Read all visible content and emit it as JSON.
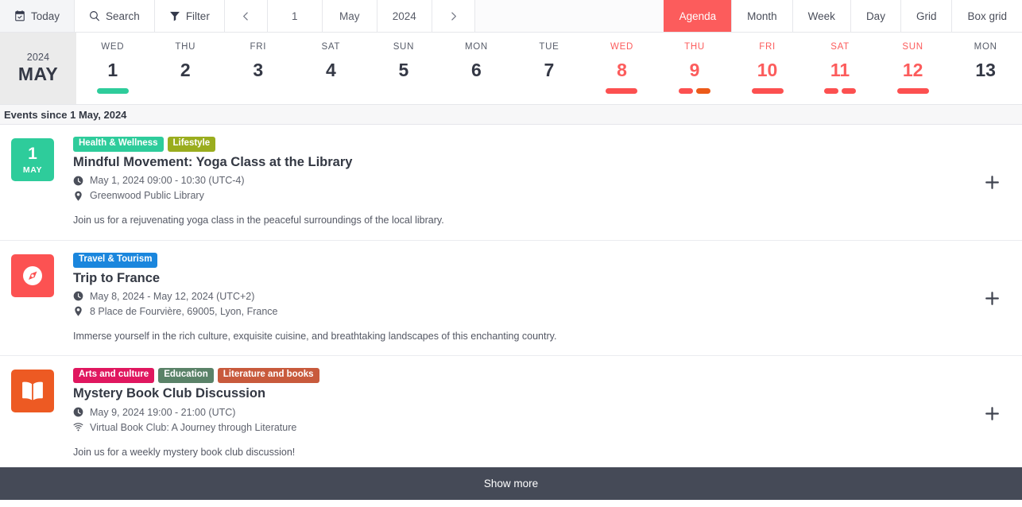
{
  "toolbar": {
    "today_label": "Today",
    "search_label": "Search",
    "filter_label": "Filter",
    "prev_label": "‹",
    "next_label": "›",
    "nav_day": "1",
    "nav_month": "May",
    "nav_year": "2024",
    "views": [
      {
        "label": "Agenda",
        "active": true
      },
      {
        "label": "Month",
        "active": false
      },
      {
        "label": "Week",
        "active": false
      },
      {
        "label": "Day",
        "active": false
      },
      {
        "label": "Grid",
        "active": false
      },
      {
        "label": "Box grid",
        "active": false
      }
    ],
    "active_accent": "#fc5c5c"
  },
  "daystrip": {
    "year": "2024",
    "month": "MAY",
    "days": [
      {
        "dow": "WED",
        "num": "1",
        "highlight": false,
        "dots": [
          {
            "size": "long",
            "color": "#2ecc9b"
          }
        ]
      },
      {
        "dow": "THU",
        "num": "2",
        "highlight": false,
        "dots": []
      },
      {
        "dow": "FRI",
        "num": "3",
        "highlight": false,
        "dots": []
      },
      {
        "dow": "SAT",
        "num": "4",
        "highlight": false,
        "dots": []
      },
      {
        "dow": "SUN",
        "num": "5",
        "highlight": false,
        "dots": []
      },
      {
        "dow": "MON",
        "num": "6",
        "highlight": false,
        "dots": []
      },
      {
        "dow": "TUE",
        "num": "7",
        "highlight": false,
        "dots": []
      },
      {
        "dow": "WED",
        "num": "8",
        "highlight": true,
        "dots": [
          {
            "size": "long",
            "color": "#fc5050"
          }
        ]
      },
      {
        "dow": "THU",
        "num": "9",
        "highlight": true,
        "dots": [
          {
            "size": "short",
            "color": "#fc5050"
          },
          {
            "size": "short",
            "color": "#ec5a19"
          }
        ]
      },
      {
        "dow": "FRI",
        "num": "10",
        "highlight": true,
        "dots": [
          {
            "size": "long",
            "color": "#fc5050"
          }
        ]
      },
      {
        "dow": "SAT",
        "num": "11",
        "highlight": true,
        "dots": [
          {
            "size": "short",
            "color": "#fc5050"
          },
          {
            "size": "short",
            "color": "#fc5050"
          }
        ]
      },
      {
        "dow": "SUN",
        "num": "12",
        "highlight": true,
        "dots": [
          {
            "size": "long",
            "color": "#fc5050"
          }
        ]
      },
      {
        "dow": "MON",
        "num": "13",
        "highlight": false,
        "dots": []
      }
    ]
  },
  "section": {
    "header": "Events since 1 May, 2024"
  },
  "events": [
    {
      "badge": {
        "type": "date",
        "day": "1",
        "month": "MAY",
        "color": "#2ecc9b"
      },
      "tags": [
        {
          "label": "Health & Wellness",
          "color": "#2ecc9b"
        },
        {
          "label": "Lifestyle",
          "color": "#9aad1e"
        }
      ],
      "title": "Mindful Movement: Yoga Class at the Library",
      "time": "May 1, 2024 09:00 - 10:30 (UTC-4)",
      "location": "Greenwood Public Library",
      "location_icon": "map-pin-icon",
      "description": "Join us for a rejuvenating yoga class in the peaceful surroundings of the local library."
    },
    {
      "badge": {
        "type": "icon",
        "icon": "compass-icon",
        "color": "#fc5252"
      },
      "tags": [
        {
          "label": "Travel & Tourism",
          "color": "#1a86dd"
        }
      ],
      "title": "Trip to France",
      "time": "May 8, 2024 - May 12, 2024 (UTC+2)",
      "location": "8 Place de Fourvière, 69005, Lyon, France",
      "location_icon": "map-pin-icon",
      "description": "Immerse yourself in the rich culture, exquisite cuisine, and breathtaking landscapes of this enchanting country."
    },
    {
      "badge": {
        "type": "icon",
        "icon": "open-book-icon",
        "color": "#ed5a23"
      },
      "tags": [
        {
          "label": "Arts and culture",
          "color": "#e0175f"
        },
        {
          "label": "Education",
          "color": "#5a8268"
        },
        {
          "label": "Literature and books",
          "color": "#c85a3c"
        }
      ],
      "title": "Mystery Book Club Discussion",
      "time": "May 9, 2024 19:00 - 21:00 (UTC)",
      "location": "Virtual Book Club: A Journey through Literature",
      "location_icon": "wifi-icon",
      "description": "Join us for a weekly mystery book club discussion!"
    }
  ],
  "footer": {
    "show_more_label": "Show more"
  }
}
